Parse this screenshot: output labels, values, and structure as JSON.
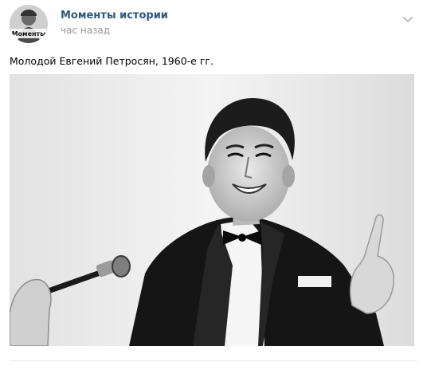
{
  "post": {
    "author": "Моменты истории",
    "time": "час назад",
    "avatar_label": "Моменты",
    "caption": "Молодой Евгений Петросян, 1960-е гг.",
    "menu_icon": "chevron-down-icon",
    "photo_subject": "young-man-with-microphone"
  },
  "colors": {
    "author_link": "#2a5885",
    "meta_text": "#939393",
    "background": "#ffffff",
    "divider": "#e7e8ec"
  }
}
